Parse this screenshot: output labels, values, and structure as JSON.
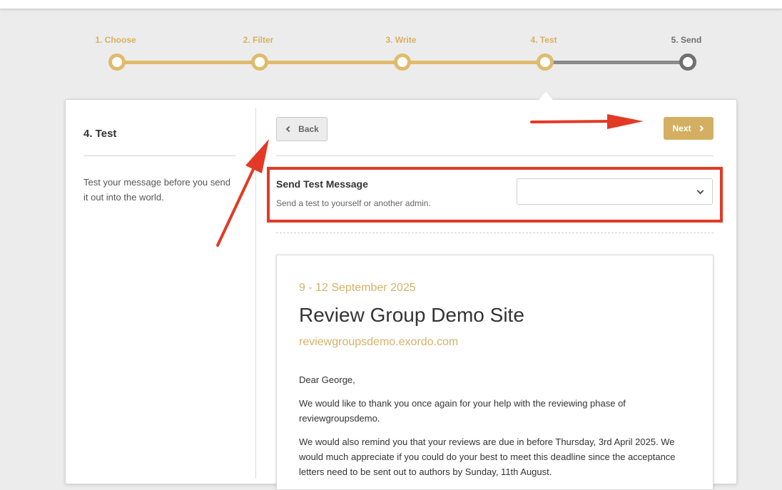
{
  "stepper": {
    "steps": [
      {
        "label": "1. Choose",
        "state": "complete"
      },
      {
        "label": "2. Filter",
        "state": "complete"
      },
      {
        "label": "3. Write",
        "state": "complete"
      },
      {
        "label": "4. Test",
        "state": "current"
      },
      {
        "label": "5. Send",
        "state": "pending"
      }
    ],
    "colors": {
      "active": "#dfbb6c",
      "inactive": "#707070"
    }
  },
  "sidebar": {
    "title": "4. Test",
    "description": "Test your message before you send it out into the world."
  },
  "toolbar": {
    "back_label": "Back",
    "next_label": "Next"
  },
  "test_message": {
    "label": "Send Test Message",
    "help": "Send a test to yourself or another admin.",
    "recipient_value": ""
  },
  "preview": {
    "date": "9 - 12 September 2025",
    "title": "Review Group Demo Site",
    "url": "reviewgroupsdemo.exordo.com",
    "greeting": "Dear George,",
    "paragraph1": "We would like to thank you once again for your help with the reviewing phase of reviewgroupsdemo.",
    "paragraph2": "We would also remind you that your reviews are due in before Thursday, 3rd April 2025. We would much appreciate if you could do your best to meet this deadline since the acceptance letters need to be sent out to authors by Sunday, 11th August."
  },
  "annotations": {
    "color": "#e23a26"
  }
}
